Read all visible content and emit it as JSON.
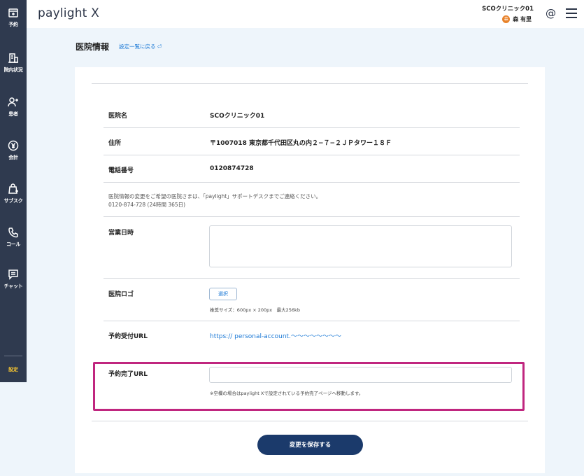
{
  "sidebar": {
    "items": [
      {
        "label": "予約",
        "icon": "calendar-plus-icon"
      },
      {
        "label": "院内状況",
        "icon": "building-icon"
      },
      {
        "label": "患者",
        "icon": "user-plus-icon"
      },
      {
        "label": "会計",
        "icon": "yen-icon"
      },
      {
        "label": "サブスク",
        "icon": "bag-plus-icon"
      },
      {
        "label": "コール",
        "icon": "phone-icon"
      },
      {
        "label": "チャット",
        "icon": "chat-icon"
      }
    ],
    "settings_label": "設定"
  },
  "header": {
    "logo": "paylight X",
    "clinic_name": "SCOクリニック01",
    "user_avatar": "森",
    "user_name": "森 有里",
    "at_symbol": "@"
  },
  "page": {
    "title": "医院情報",
    "back_link": "設定一覧に戻る ⏎"
  },
  "form": {
    "clinic_name_label": "医院名",
    "clinic_name_value": "SCOクリニック01",
    "address_label": "住所",
    "address_value": "〒1007018 東京都千代田区丸の内２−７−２ＪＰタワー１８Ｆ",
    "phone_label": "電話番号",
    "phone_value": "0120874728",
    "change_note_line1": "医院情報の変更をご希望の医院さまは、「paylight」サポートデスクまでご連絡ください。",
    "change_note_line2": "0120-874-728 (24時間 365日)",
    "hours_label": "営業日時",
    "logo_label": "医院ロゴ",
    "select_button": "選択",
    "logo_note": "推奨サイズ：600px × 200px　最大256kb",
    "booking_url_label": "予約受付URL",
    "booking_url_value": "https:// personal-account.〜〜〜〜〜〜〜〜",
    "complete_url_label": "予約完了URL",
    "complete_url_note": "※空欄の場合はpaylight Xで設定されている予約完了ページへ移動します。",
    "save_button": "変更を保存する"
  },
  "colors": {
    "sidebar": "#2f3a4f",
    "accent_link": "#1d7ad6",
    "highlight_border": "#c0267f",
    "save_button": "#1b3a6b",
    "settings_active": "#f5c431"
  }
}
